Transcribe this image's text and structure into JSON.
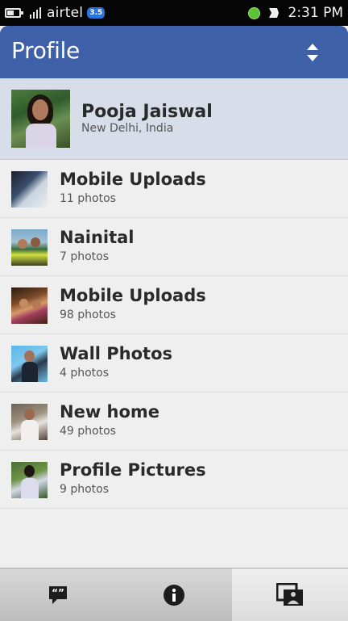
{
  "status_bar": {
    "carrier": "airtel",
    "network_badge": "3.5",
    "time": "2:31 PM"
  },
  "header": {
    "title": "Profile",
    "color": "#3e60a8"
  },
  "profile": {
    "name": "Pooja Jaiswal",
    "location": "New Delhi, India"
  },
  "albums": [
    {
      "title": "Mobile Uploads",
      "count": "11 photos"
    },
    {
      "title": "Nainital",
      "count": "7 photos"
    },
    {
      "title": "Mobile Uploads",
      "count": "98 photos"
    },
    {
      "title": "Wall Photos",
      "count": "4 photos"
    },
    {
      "title": "New home",
      "count": "49 photos"
    },
    {
      "title": "Profile Pictures",
      "count": "9 photos"
    }
  ],
  "toolbar": {
    "items": [
      "comments-icon",
      "info-icon",
      "photos-icon"
    ],
    "active": "photos-icon"
  }
}
